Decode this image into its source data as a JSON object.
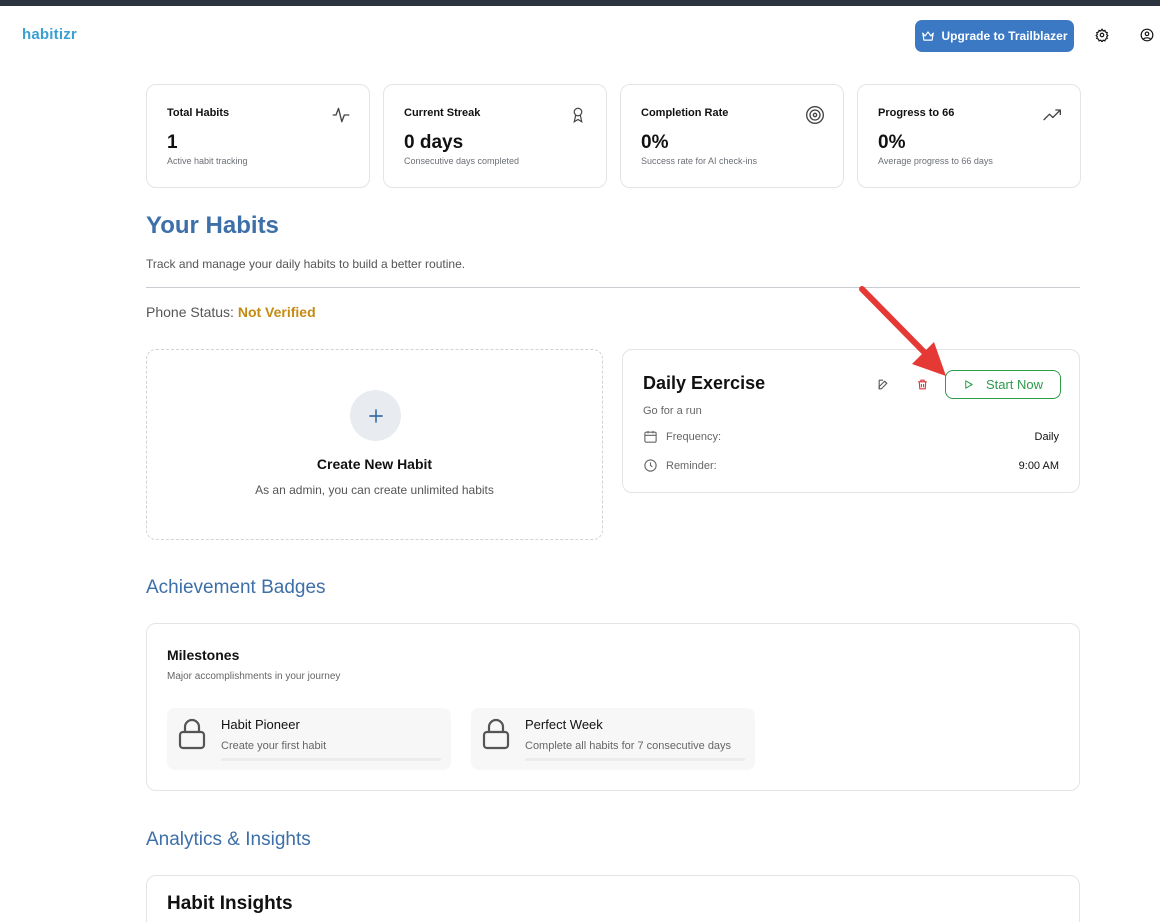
{
  "app": {
    "logo": "habitizr"
  },
  "header": {
    "upgrade_label": "Upgrade to Trailblazer",
    "icons": [
      "crown-icon",
      "gear-icon",
      "user-circle-icon"
    ]
  },
  "stats": [
    {
      "title": "Total Habits",
      "value": "1",
      "sub": "Active habit tracking",
      "icon": "activity-icon"
    },
    {
      "title": "Current Streak",
      "value": "0 days",
      "sub": "Consecutive days completed",
      "icon": "award-icon"
    },
    {
      "title": "Completion Rate",
      "value": "0%",
      "sub": "Success rate for AI check-ins",
      "icon": "target-icon"
    },
    {
      "title": "Progress to 66",
      "value": "0%",
      "sub": "Average progress to 66 days",
      "icon": "trending-up-icon"
    }
  ],
  "habits_section": {
    "title": "Your Habits",
    "subtitle": "Track and manage your daily habits to build a better routine.",
    "phone_label": "Phone Status:",
    "phone_value": "Not Verified",
    "create": {
      "title": "Create New Habit",
      "sub": "As an admin, you can create unlimited habits"
    },
    "habit": {
      "name": "Daily Exercise",
      "description": "Go for a run",
      "frequency_label": "Frequency:",
      "frequency_value": "Daily",
      "reminder_label": "Reminder:",
      "reminder_value": "9:00 AM",
      "start_label": "Start Now"
    }
  },
  "badges_section": {
    "title": "Achievement Badges",
    "card_title": "Milestones",
    "card_sub": "Major accomplishments in your journey",
    "badges": [
      {
        "title": "Habit Pioneer",
        "sub": "Create your first habit"
      },
      {
        "title": "Perfect Week",
        "sub": "Complete all habits for 7 consecutive days"
      }
    ]
  },
  "analytics_section": {
    "title": "Analytics & Insights",
    "card_title": "Habit Insights"
  },
  "colors": {
    "accent": "#3d6fa8",
    "upgrade_bg": "#3b79c4",
    "warning": "#c58a12",
    "success": "#2c9b4b",
    "danger": "#d9363e",
    "annotation_arrow": "#e53935"
  }
}
